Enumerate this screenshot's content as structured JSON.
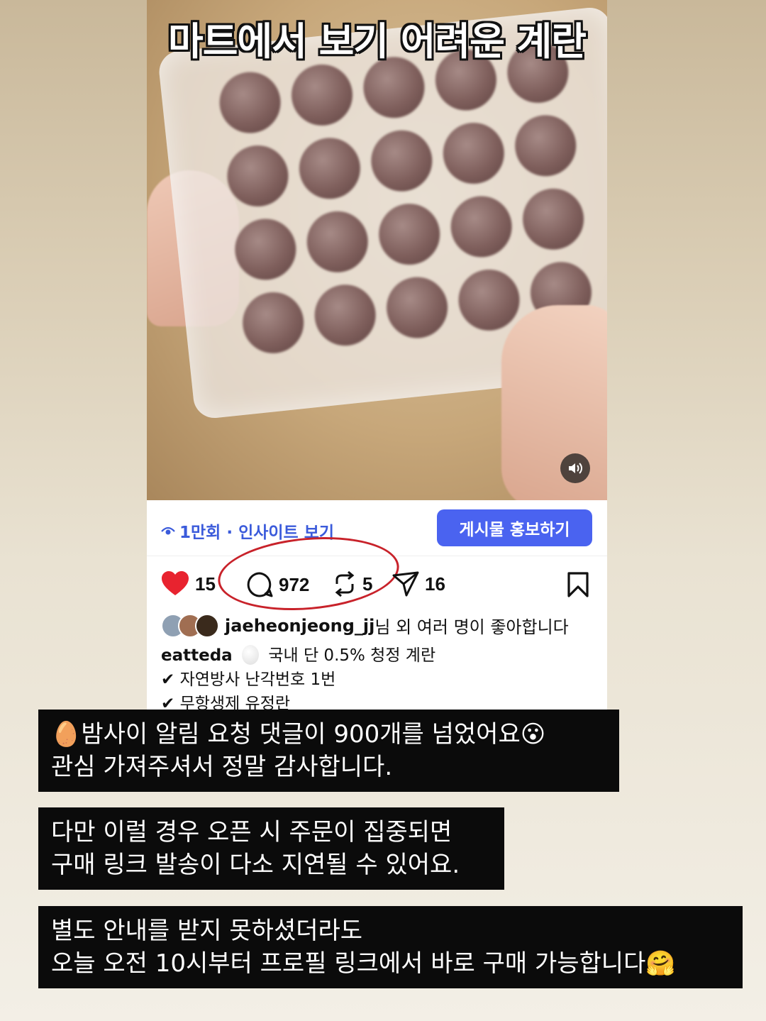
{
  "post": {
    "overlay_title": "마트에서 보기 어려운 계란",
    "views": "1만회 · 인사이트 보기",
    "promote_label": "게시물 홍보하기",
    "likes": "15",
    "comments": "972",
    "reposts": "5",
    "shares": "16",
    "liked_by_user": "jaeheonjeong_jj",
    "liked_by_suffix": "님 외 여러 명이 좋아합니다",
    "author": "eatteda",
    "caption_line1": "국내 단 0.5% 청정 계란",
    "caption_line2": "✔ 자연방사 난각번호 1번",
    "caption_line3": "✔ 무항생제 유정란"
  },
  "notices": [
    {
      "line1": "🥚밤사이 알림 요청 댓글이 900개를 넘었어요😮",
      "line2": "관심 가져주셔서 정말 감사합니다."
    },
    {
      "line1": "다만 이럴 경우 오픈 시 주문이 집중되면",
      "line2": "구매 링크 발송이 다소 지연될 수 있어요."
    },
    {
      "line1": "별도 안내를 받지 못하셨더라도",
      "line2": "오늘 오전 10시부터 프로필 링크에서 바로 구매 가능합니다🤗"
    }
  ],
  "colors": {
    "accent": "#4a63f0",
    "heart": "#e8232f",
    "annotation": "#c8222a"
  }
}
